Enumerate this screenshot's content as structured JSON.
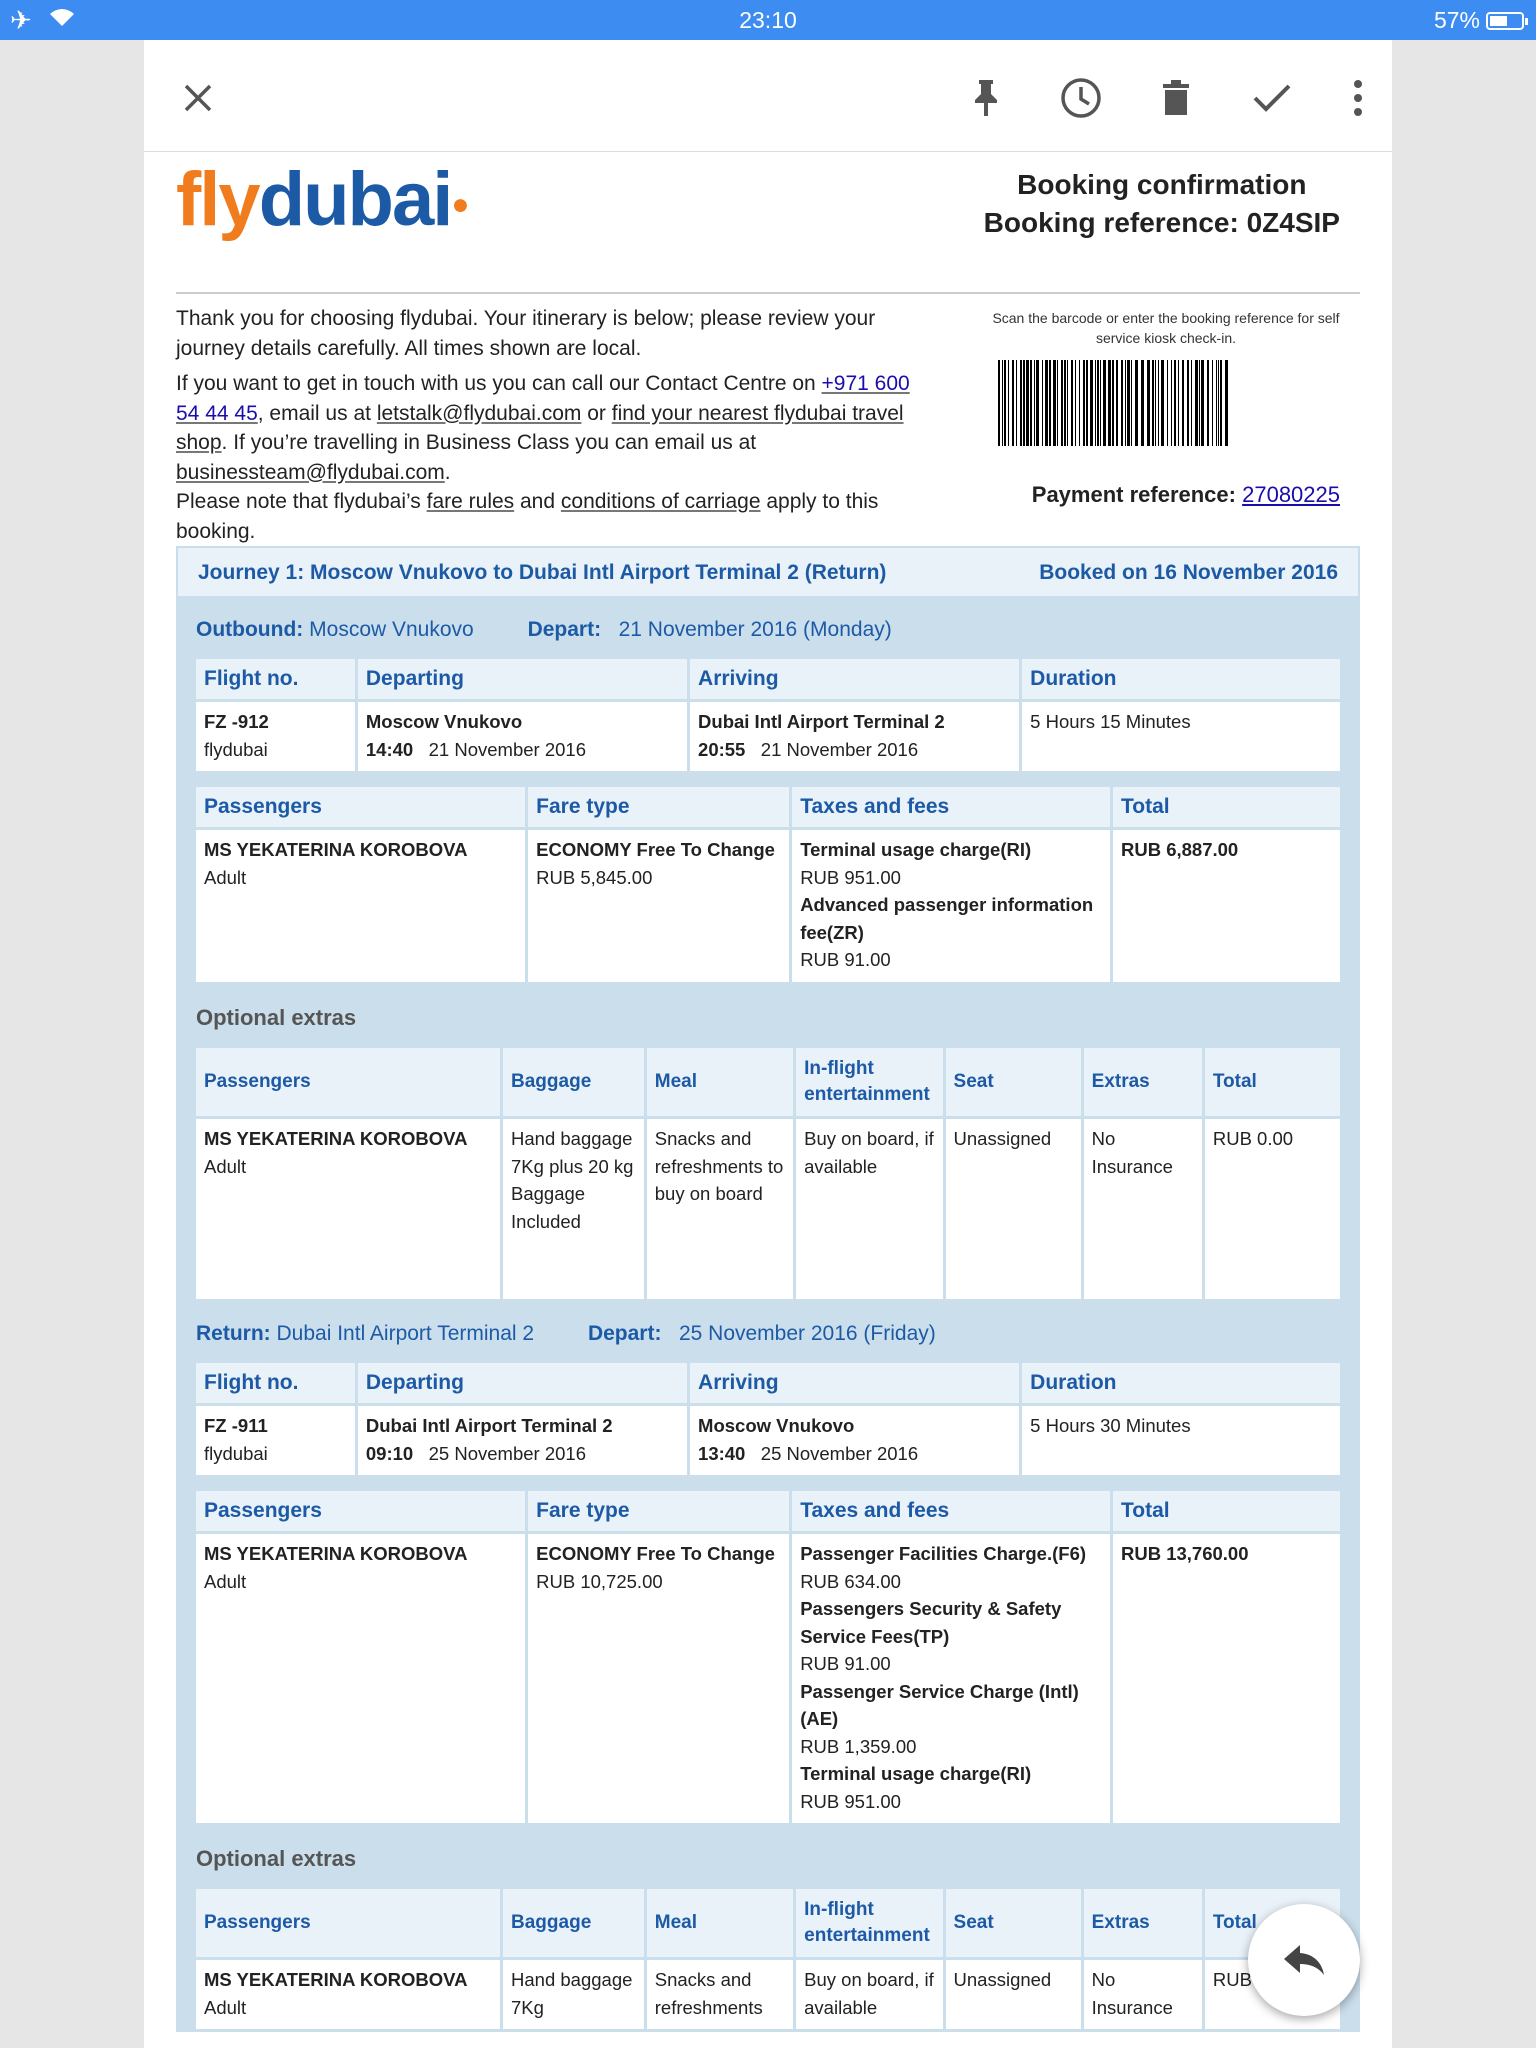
{
  "status": {
    "time": "23:10",
    "battery": "57%",
    "battery_level": 0.57
  },
  "brand": {
    "fly": "fly",
    "dubai": "dubai"
  },
  "header": {
    "title": "Booking confirmation",
    "reference": "Booking reference: 0Z4SIP"
  },
  "intro": {
    "p1": "Thank you for choosing flydubai. Your itinerary is below; please review your journey details carefully. All times shown are local.",
    "p2a": "If you want to get in touch with us you can call our Contact Centre on ",
    "phone": "+971 600 54 44 45",
    "p2b": ", email us at ",
    "email": "letstalk@flydubai.com",
    "p2c": " or ",
    "shop": "find your nearest flydubai travel shop",
    "p2d": ". If you’re travelling in Business Class you can email us at ",
    "bizemail": "businessteam@flydubai.com",
    "p2e": ".",
    "p3a": "Please note that flydubai’s ",
    "farerules": "fare rules",
    "p3b": " and ",
    "conditions": "conditions of carriage",
    "p3c": " apply to this booking."
  },
  "scan": "Scan the barcode or enter the booking reference for self service kiosk check-in.",
  "payment": {
    "label": "Payment reference:",
    "value": "27080225"
  },
  "journey": {
    "title": "Journey 1: Moscow Vnukovo to Dubai Intl Airport Terminal 2 (Return)",
    "booked": "Booked on 16  November  2016"
  },
  "flight_headers": {
    "flight": "Flight no.",
    "departing": "Departing",
    "arriving": "Arriving",
    "duration": "Duration"
  },
  "pax_headers": {
    "passengers": "Passengers",
    "fare": "Fare type",
    "taxes": "Taxes and fees",
    "total": "Total"
  },
  "extras_headers": {
    "label": "Optional extras",
    "passengers": "Passengers",
    "baggage": "Baggage",
    "meal": "Meal",
    "ife": "In-flight entertainment",
    "seat": "Seat",
    "extras": "Extras",
    "total": "Total"
  },
  "outbound": {
    "label": "Outbound:",
    "from": "Moscow Vnukovo",
    "depart_label": "Depart:",
    "date": "21  November  2016  (Monday)",
    "flight": "FZ -912",
    "carrier": "flydubai",
    "dep_place": "Moscow Vnukovo",
    "dep_time": "14:40",
    "dep_date": "21  November  2016",
    "arr_place": "Dubai Intl Airport Terminal 2",
    "arr_time": "20:55",
    "arr_date": "21  November  2016",
    "duration": "5 Hours  15 Minutes",
    "pax_name": "MS YEKATERINA  KOROBOVA",
    "pax_type": "Adult",
    "fare_name": "ECONOMY  Free To Change",
    "fare_price": "RUB 5,845.00",
    "taxes": [
      {
        "name": "Terminal usage charge(RI)",
        "amount": "RUB  951.00"
      },
      {
        "name": "Advanced passenger information fee(ZR)",
        "amount": "RUB  91.00"
      }
    ],
    "total": "RUB 6,887.00",
    "x_baggage": "Hand baggage 7Kg plus 20 kg Baggage Included",
    "x_meal": "Snacks and refreshments to buy on board",
    "x_ife": "Buy on board, if available",
    "x_seat": "Unassigned",
    "x_extras": "No Insurance",
    "x_total": "RUB 0.00"
  },
  "return": {
    "label": "Return:",
    "from": "Dubai Intl Airport Terminal 2",
    "depart_label": "Depart:",
    "date": "25  November  2016  (Friday)",
    "flight": "FZ -911",
    "carrier": "flydubai",
    "dep_place": "Dubai Intl Airport Terminal 2",
    "dep_time": "09:10",
    "dep_date": "25  November  2016",
    "arr_place": "Moscow Vnukovo",
    "arr_time": "13:40",
    "arr_date": "25  November  2016",
    "duration": "5 Hours  30 Minutes",
    "pax_name": "MS YEKATERINA  KOROBOVA",
    "pax_type": "Adult",
    "fare_name": "ECONOMY  Free To Change",
    "fare_price": "RUB 10,725.00",
    "taxes": [
      {
        "name": "Passenger Facilities Charge.(F6)",
        "amount": "RUB  634.00"
      },
      {
        "name": "Passengers Security & Safety Service Fees(TP)",
        "amount": "RUB  91.00"
      },
      {
        "name": "Passenger Service Charge (Intl)(AE)",
        "amount": "RUB  1,359.00"
      },
      {
        "name": "Terminal usage charge(RI)",
        "amount": "RUB  951.00"
      }
    ],
    "total": "RUB 13,760.00",
    "x_baggage": "Hand baggage 7Kg",
    "x_meal": "Snacks and refreshments",
    "x_ife": "Buy on board, if available",
    "x_seat": "Unassigned",
    "x_extras": "No Insurance",
    "x_total": "RUB 0.00"
  }
}
